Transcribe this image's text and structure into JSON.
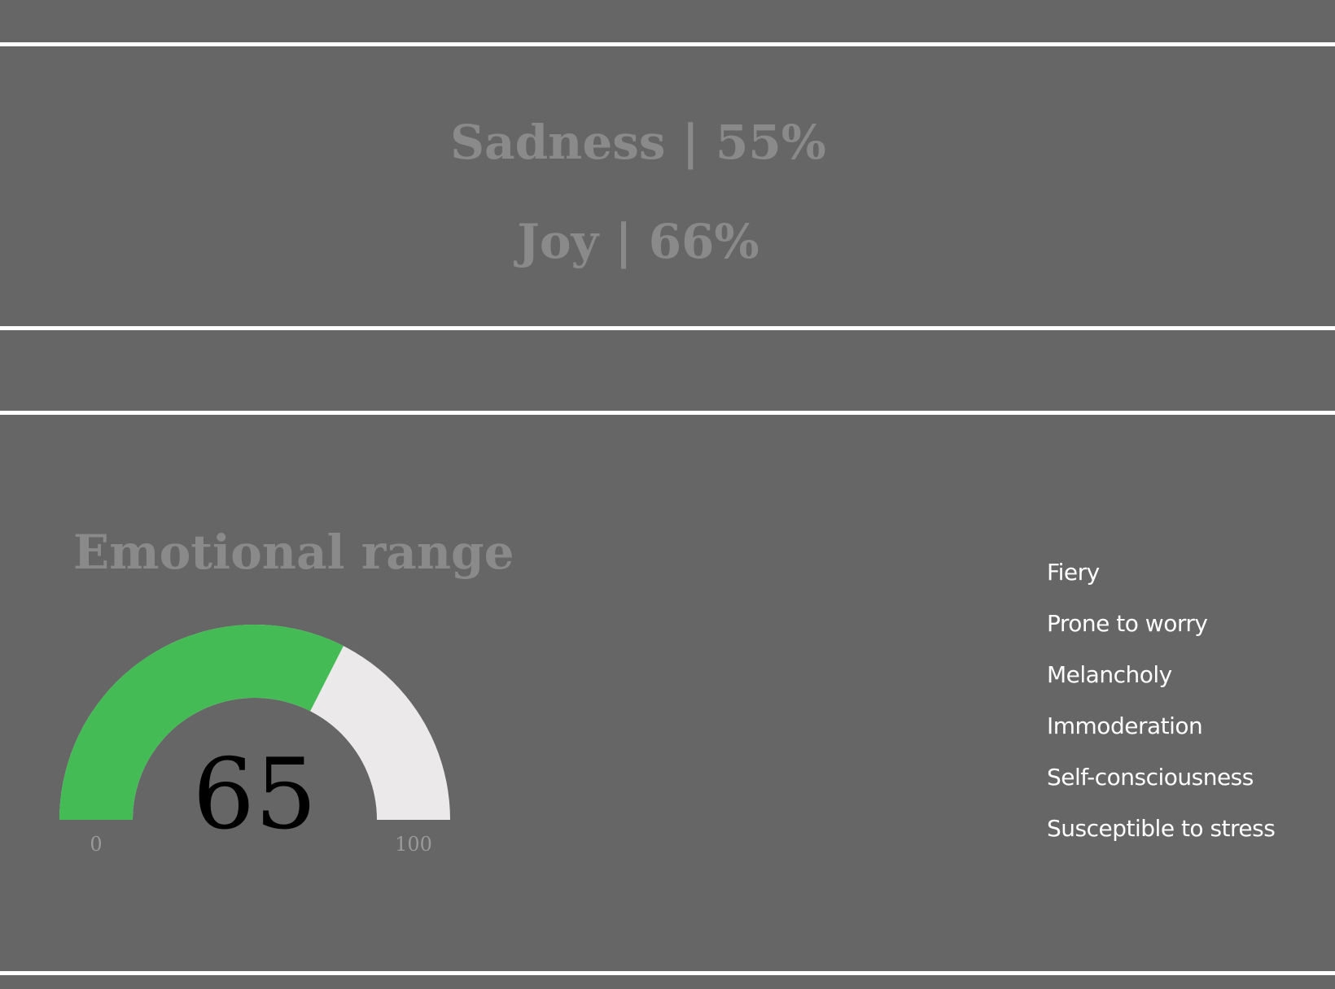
{
  "emotions": [
    {
      "label": "Sadness | 55%"
    },
    {
      "label": "Joy | 66%"
    }
  ],
  "emotional_range": {
    "title": "Emotional range"
  },
  "traits": [
    "Fiery",
    "Prone to worry",
    "Melancholy",
    "Immoderation",
    "Self-consciousness",
    "Susceptible to stress"
  ],
  "chart_data": {
    "type": "gauge",
    "title": "Emotional range",
    "value": 65,
    "value_label": "65",
    "min": 0,
    "max": 100,
    "min_label": "0",
    "max_label": "100",
    "fill_color": "#44bb55",
    "track_color": "#ebe9ea",
    "value_text_color": "#000000"
  },
  "colors": {
    "background": "#666666",
    "divider": "#ffffff",
    "heading_text": "#8a8a8a",
    "trait_text": "#ffffff"
  }
}
